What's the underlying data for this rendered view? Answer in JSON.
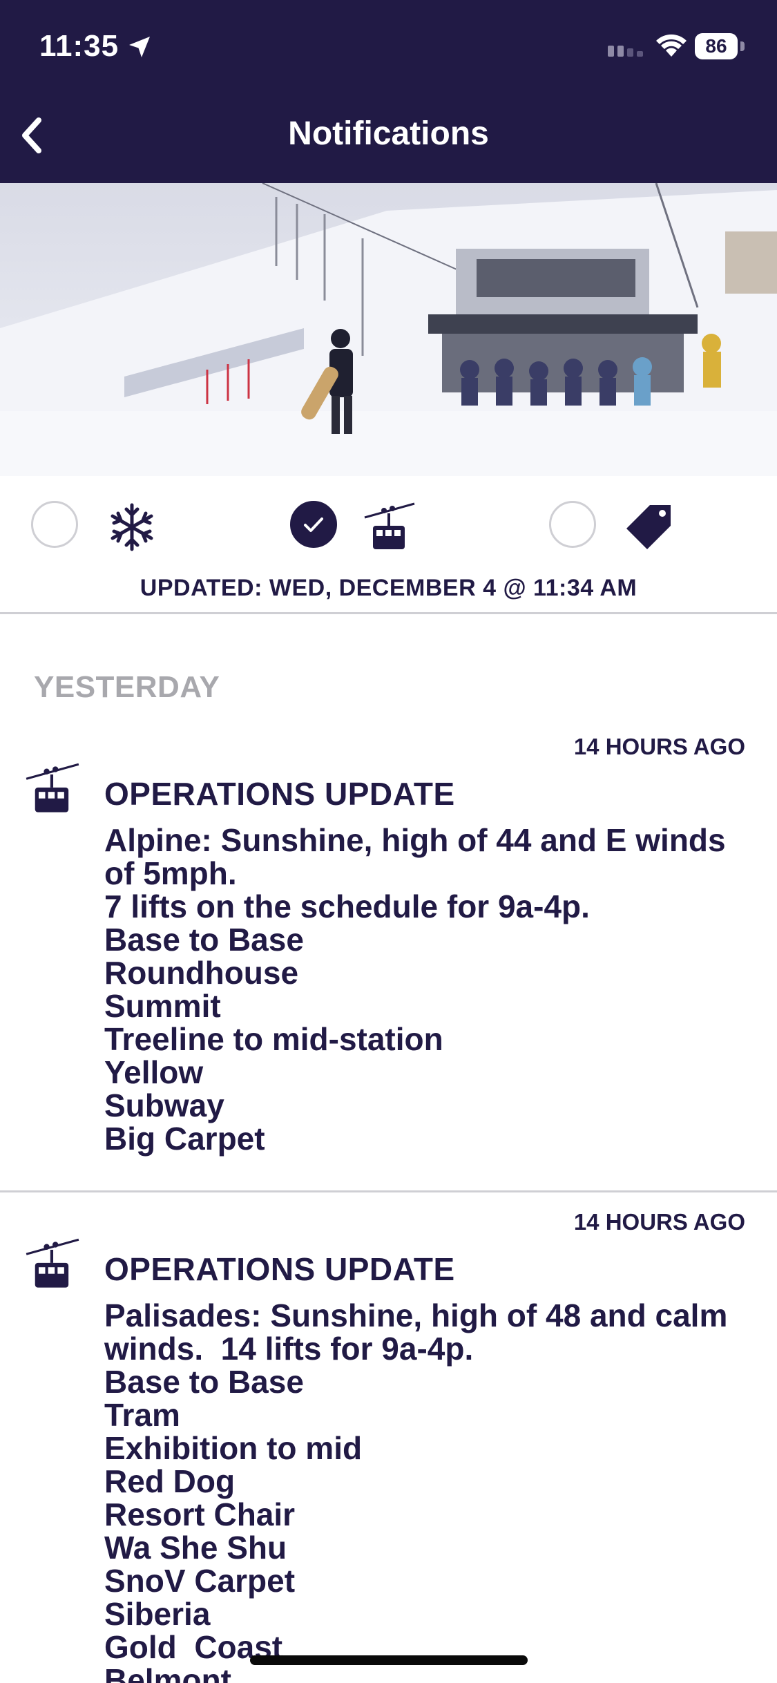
{
  "status_bar": {
    "time": "11:35",
    "battery": "86"
  },
  "header": {
    "title": "Notifications"
  },
  "filters": [
    {
      "icon": "snowflake-icon",
      "checked": false
    },
    {
      "icon": "gondola-icon",
      "checked": true
    },
    {
      "icon": "tag-icon",
      "checked": false
    }
  ],
  "updated_text": "UPDATED: WED, DECEMBER 4 @ 11:34 AM",
  "section_heading": "YESTERDAY",
  "notifications": [
    {
      "time": "14 HOURS AGO",
      "title": "OPERATIONS UPDATE",
      "lines": [
        "Alpine: Sunshine, high of 44 and E winds",
        "of 5mph.",
        "7 lifts on the schedule for 9a-4p.",
        "Base to Base",
        "Roundhouse",
        "Summit",
        "Treeline to mid-station",
        "Yellow",
        "Subway",
        "Big Carpet"
      ]
    },
    {
      "time": "14 HOURS AGO",
      "title": "OPERATIONS UPDATE",
      "lines": [
        "Palisades: Sunshine, high of 48 and calm",
        "winds.  14 lifts for 9a-4p.",
        "Base to Base",
        "Tram",
        "Exhibition to mid",
        "Red Dog",
        "Resort Chair",
        "Wa She Shu",
        "SnoV Carpet",
        "Siberia",
        "Gold  Coast",
        "Belmont"
      ]
    }
  ],
  "colors": {
    "brand": "#211a45",
    "divider": "#cfcfd4",
    "muted": "#a8a8ad"
  }
}
